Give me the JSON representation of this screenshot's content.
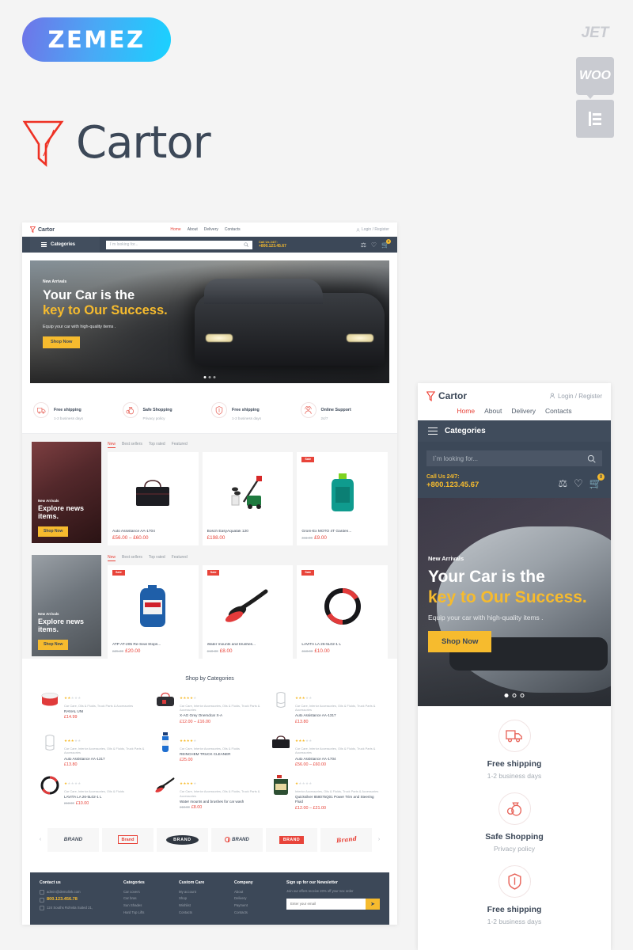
{
  "branding": {
    "vendor_logo": "ZEMEZ",
    "badges": [
      "JET",
      "WOO",
      "elementor-icon"
    ],
    "product_name": "Cartor",
    "logo_icon": "funnel-icon"
  },
  "header": {
    "logo": "Cartor",
    "nav": [
      {
        "label": "Home",
        "active": true
      },
      {
        "label": "About",
        "active": false
      },
      {
        "label": "Delivery",
        "active": false
      },
      {
        "label": "Contacts",
        "active": false
      }
    ],
    "login": "Login / Register",
    "login_icon": "user-icon",
    "categories_label": "Categories",
    "menu_icon": "hamburger-icon",
    "search_placeholder": "I`m looking for...",
    "search_icon": "search-icon",
    "call_label": "Call Us 24/7:",
    "phone": "+800.123.45.67",
    "compare_icon": "scales-icon",
    "wishlist_icon": "heart-icon",
    "cart_icon": "cart-icon",
    "cart_count": "0"
  },
  "hero": {
    "kicker": "New Arrivals",
    "line1": "Your Car is the",
    "line2": "key to Our Success.",
    "subtitle": "Equip your car with high-quality items .",
    "button": "Shop Now",
    "slides": 3,
    "active_slide": 1
  },
  "features": [
    {
      "icon": "truck-icon",
      "title": "Free shipping",
      "subtitle": "1-2 business days"
    },
    {
      "icon": "money-bag-icon",
      "title": "Safe Shopping",
      "subtitle": "Privacy policy"
    },
    {
      "icon": "shield-icon",
      "title": "Free shipping",
      "subtitle": "1-2 business days"
    },
    {
      "icon": "support-agent-icon",
      "title": "Online Support",
      "subtitle": "24/7"
    }
  ],
  "product_tabs": [
    "New",
    "Best sellers",
    "Top rated",
    "Featured"
  ],
  "promo_blocks": [
    {
      "kicker": "New Arrivals",
      "title": "Explore news items.",
      "button": "Shop Now",
      "theme": "seat"
    },
    {
      "kicker": "New Arrivals",
      "title": "Explore news items.",
      "button": "Shop Now",
      "theme": "oil"
    }
  ],
  "products_row1": [
    {
      "name": "Auto Assistance AA-1704",
      "price": "£56.00 – £60.00",
      "old_price": "",
      "sale": false,
      "img": "bag-icon"
    },
    {
      "name": "Bosch EasyAquatak 120",
      "price": "£198.00",
      "old_price": "",
      "sale": false,
      "img": "pressure-washer-icon"
    },
    {
      "name": "Grom-Ex MOTO 4T Garden...",
      "price": "£9.00",
      "old_price": "£11.00",
      "sale": true,
      "img": "oil-bottle-icon"
    }
  ],
  "products_row2": [
    {
      "name": "ATP AT-205 Re-Seal Stops...",
      "price": "£20.00",
      "old_price": "£25.00",
      "sale": true,
      "img": "helix-oil-icon"
    },
    {
      "name": "Water mounts and brushes...",
      "price": "£8.00",
      "old_price": "£10.00",
      "sale": true,
      "img": "brush-icon"
    },
    {
      "name": "LAVITA LA 26-5L02-1 L",
      "price": "£10.00",
      "old_price": "£13.00",
      "sale": true,
      "img": "steering-wheel-icon"
    }
  ],
  "categories_section": {
    "title": "Shop by Categories",
    "items": [
      {
        "stars": 2,
        "cats": "Car Care, Oils & Fluids, Truck Parts & Accessories",
        "name": "RANAL UNI",
        "price": "£14.99",
        "old_price": "",
        "img": "paint-can-icon"
      },
      {
        "stars": 4,
        "cats": "Car Care, Interior Accessories, Oils & Fluids, Truck Parts & Accessories",
        "name": "X-AG Grey Onemdcar X-A",
        "price": "£12.00 – £16.00",
        "old_price": "",
        "img": "bag-red-icon"
      },
      {
        "stars": 3,
        "cats": "Car Care, Interior Accessories, Oils & Fluids, Truck Parts & Accessories",
        "name": "Auto Assistance AA-1317",
        "price": "£13.80",
        "old_price": "",
        "img": "cover-icon"
      },
      {
        "stars": 3,
        "cats": "Car Care, Interior Accessories, Oils & Fluids, Truck Parts & Accessories",
        "name": "Auto Assistance AA-1317",
        "price": "£13.80",
        "old_price": "",
        "img": "cover-icon"
      },
      {
        "stars": 4,
        "cats": "Car Care, Interior Accessories, Oils & Fluids",
        "name": "REINCHEM TRUCK CLEANER",
        "price": "£25.00",
        "old_price": "",
        "img": "cleaner-bottle-icon"
      },
      {
        "stars": 3,
        "cats": "Car Care, Interior Accessories, Oils & Fluids, Truck Parts & Accessories",
        "name": "Auto Assistance AA-1704",
        "price": "£56.00 – £60.00",
        "old_price": "",
        "img": "bag-icon"
      },
      {
        "stars": 1,
        "cats": "Car Care, Interior Accessories, Oils & Fluids",
        "name": "LAVITA LA 26-5L02-1 L",
        "price": "£10.00",
        "old_price": "£13.00",
        "img": "steering-wheel-icon"
      },
      {
        "stars": 4,
        "cats": "Car Care, Interior Accessories, Oils & Fluids, Truck Parts & Accessories",
        "name": "Water mounts and brushes for car wash",
        "price": "£8.00",
        "old_price": "£10.00",
        "img": "brush-icon"
      },
      {
        "stars": 1,
        "cats": "Interior Accessories, Oils & Fluids, Truck Parts & Accessories",
        "name": "Quicksilver 858075Q01 Power Trim and Steering Fluid",
        "price": "£12.00 – £21.00",
        "old_price": "",
        "img": "green-oil-icon"
      }
    ]
  },
  "brands": {
    "prev_icon": "chevron-left-icon",
    "next_icon": "chevron-right-icon",
    "items": [
      "BRAND",
      "Brand",
      "BRAND",
      "BRAND",
      "BRAND",
      "Brand"
    ]
  },
  "footer": {
    "columns": [
      {
        "title": "Contact us",
        "email": "admin@demolink.com",
        "phone": "800.123.456.78",
        "address": "124 Souths Rohvita Suited 21,",
        "email_icon": "mail-icon",
        "phone_icon": "phone-icon",
        "pin_icon": "pin-icon"
      },
      {
        "title": "Categories",
        "links": [
          "Car covers",
          "Car bras",
          "Sun Shades",
          "Hard Top Lifts"
        ]
      },
      {
        "title": "Custom Care",
        "links": [
          "My account",
          "Shop",
          "Wishlist",
          "Contacts"
        ]
      },
      {
        "title": "Company",
        "links": [
          "About",
          "Delivery",
          "Payment",
          "Contacts"
        ]
      }
    ],
    "newsletter": {
      "title": "Sign up for our Newsletter",
      "subtitle": "Join our offers receive 20% off your nex order",
      "placeholder": "Enter your email",
      "button_icon": "send-icon"
    }
  },
  "mobile_features": [
    {
      "icon": "truck-icon",
      "title": "Free shipping",
      "subtitle": "1-2 business days"
    },
    {
      "icon": "money-bag-icon",
      "title": "Safe Shopping",
      "subtitle": "Privacy policy"
    },
    {
      "icon": "shield-icon",
      "title": "Free shipping",
      "subtitle": "1-2 business days"
    }
  ],
  "colors": {
    "accent_red": "#e8443a",
    "accent_yellow": "#f6bb2e",
    "dark_navy": "#3c4858",
    "page_bg": "#f4f4f4"
  }
}
